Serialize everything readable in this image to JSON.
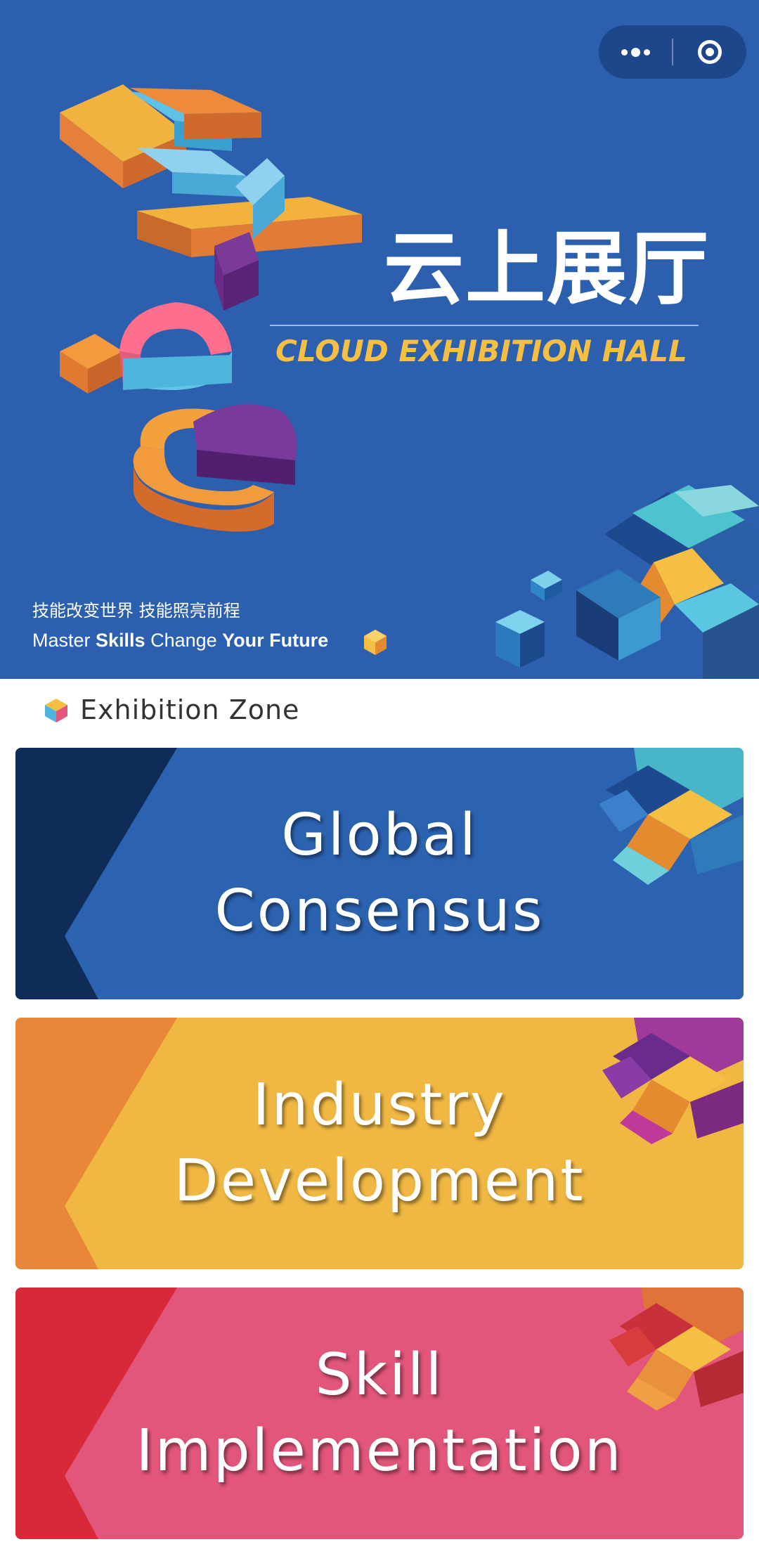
{
  "window": {
    "capsule": {
      "more_icon": "more-dots-icon",
      "close_icon": "target-circle-icon"
    }
  },
  "hero": {
    "title_cn": "云上展厅",
    "title_en": "CLOUD EXHIBITION HALL",
    "slogan_cn": "技能改变世界 技能照亮前程",
    "slogan_en": {
      "part1": "Master ",
      "part2": "Skills",
      "part3": " Change ",
      "part4": "Your Future"
    },
    "artwork_letters": "EXPO",
    "colors": {
      "background": "#2c5fae",
      "accent_yellow": "#f4bf43"
    }
  },
  "section": {
    "title": "Exhibition Zone",
    "icon": "colored-cube-icon"
  },
  "zones": [
    {
      "line1": "Global",
      "line2": "Consensus",
      "colors": {
        "main": "#2c63b1",
        "edge": "#0f2c58"
      }
    },
    {
      "line1": "Industry",
      "line2": "Development",
      "colors": {
        "main": "#f0b843",
        "edge": "#e8863a"
      }
    },
    {
      "line1": "Skill",
      "line2": "Implementation",
      "colors": {
        "main": "#e1567a",
        "edge": "#d8293a"
      }
    }
  ]
}
